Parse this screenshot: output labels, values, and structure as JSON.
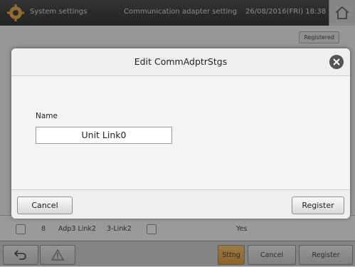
{
  "topbar": {
    "title": "System settings",
    "subtitle": "Communication adapter setting",
    "datetime": "26/08/2016(FRI) 18:38"
  },
  "background": {
    "registered_label": "Registered",
    "row": {
      "index": "8",
      "name": "Adp3 Link2",
      "code": "3-Link2",
      "status": "Yes"
    }
  },
  "bottombar": {
    "sttng_label": "Sttng",
    "cancel_label": "Cancel",
    "register_label": "Register"
  },
  "dialog": {
    "title": "Edit CommAdptrStgs",
    "name_label": "Name",
    "name_value": "Unit Link0",
    "cancel_label": "Cancel",
    "register_label": "Register"
  },
  "colors": {
    "topbar": "#2a2a2a",
    "sttng_button": "#e8a33a",
    "close_button": "#555555"
  }
}
